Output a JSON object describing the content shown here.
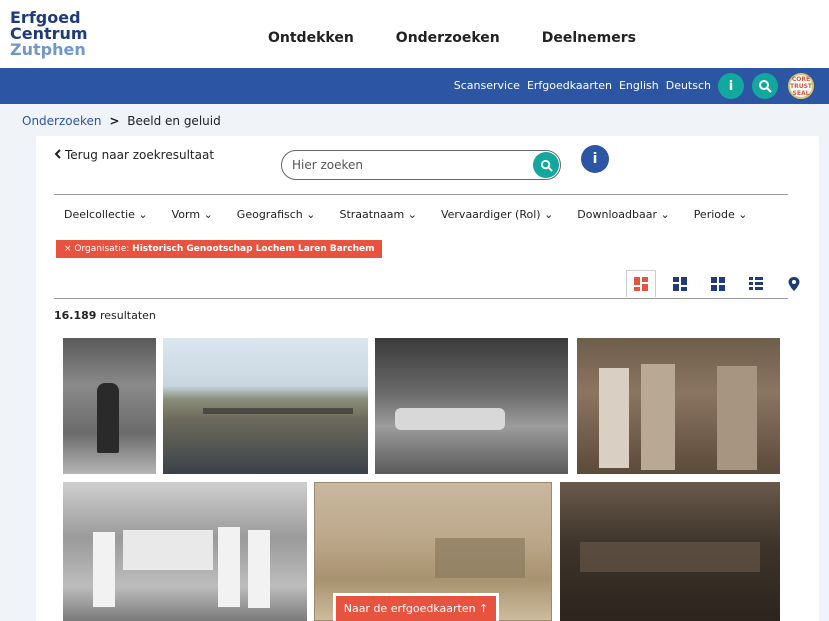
{
  "brand": {
    "line1": "Erfgoed",
    "line2": "Centrum",
    "line3": "Zutphen"
  },
  "nav": [
    "Ontdekken",
    "Onderzoeken",
    "Deelnemers"
  ],
  "toplinks": [
    "Scanservice",
    "Erfgoedkaarten",
    "English",
    "Deutsch"
  ],
  "toolbar": {
    "info": "i",
    "seal": "CORE TRUST SEAL"
  },
  "breadcrumb": {
    "parent": "Onderzoeken",
    "sep": ">",
    "current": "Beeld en geluid"
  },
  "back_link": "Terug naar zoekresultaat",
  "search": {
    "placeholder": "Hier zoeken"
  },
  "info_label": "i",
  "filters": [
    "Deelcollectie",
    "Vorm",
    "Geografisch",
    "Straatnaam",
    "Vervaardiger (Rol)",
    "Downloadbaar",
    "Periode"
  ],
  "active_filter": {
    "remove": "×",
    "label": "Organisatie:",
    "value": "Historisch Genootschap Lochem Laren Barchem"
  },
  "results": {
    "count": "16.189",
    "label": "resultaten"
  },
  "map_button": "Naar de erfgoedkaarten ↑",
  "colors": {
    "brand_blue": "#2c55a3",
    "teal": "#13a89e",
    "accent_red": "#e8533f"
  }
}
